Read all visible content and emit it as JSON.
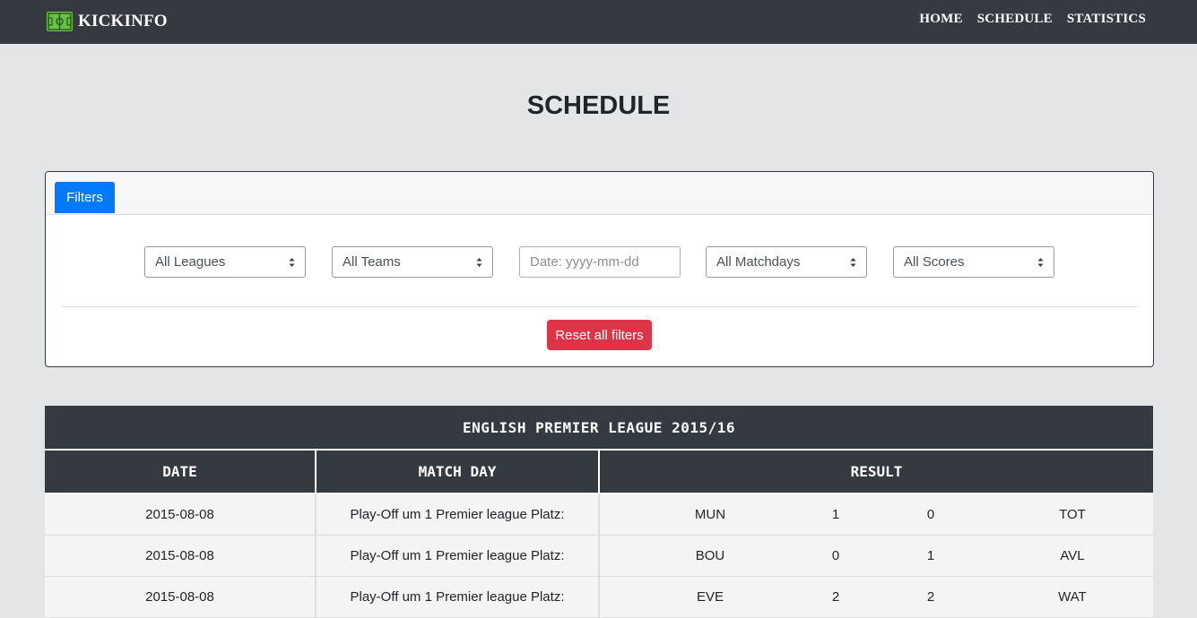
{
  "brand": {
    "name": "KICKINFO",
    "logo_icon": "football-pitch-icon"
  },
  "nav": {
    "items": [
      "HOME",
      "SCHEDULE",
      "STATISTICS"
    ]
  },
  "page": {
    "title": "SCHEDULE"
  },
  "filters": {
    "tab_label": "Filters",
    "league_select": "All Leagues",
    "team_select": "All Teams",
    "date_placeholder": "Date: yyyy-mm-dd",
    "matchday_select": "All Matchdays",
    "score_select": "All Scores",
    "reset_label": "Reset all filters"
  },
  "colors": {
    "navbar": "#343a40",
    "tab_active": "#007bff",
    "reset": "#dc3545"
  },
  "table": {
    "title": "ENGLISH PREMIER LEAGUE 2015/16",
    "headers": [
      "DATE",
      "MATCH DAY",
      "RESULT"
    ],
    "rows": [
      {
        "date": "2015-08-08",
        "matchday": "Play-Off um 1 Premier league Platz:",
        "home": "MUN",
        "home_score": "1",
        "away_score": "0",
        "away": "TOT"
      },
      {
        "date": "2015-08-08",
        "matchday": "Play-Off um 1 Premier league Platz:",
        "home": "BOU",
        "home_score": "0",
        "away_score": "1",
        "away": "AVL"
      },
      {
        "date": "2015-08-08",
        "matchday": "Play-Off um 1 Premier league Platz:",
        "home": "EVE",
        "home_score": "2",
        "away_score": "2",
        "away": "WAT"
      }
    ]
  }
}
